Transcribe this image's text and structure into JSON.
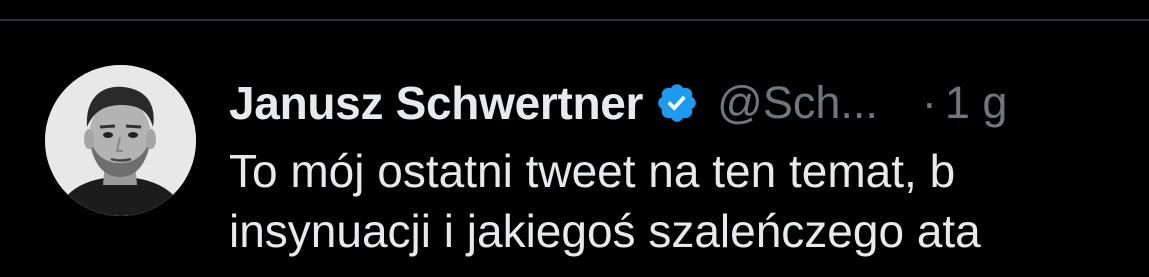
{
  "tweet": {
    "display_name": "Janusz Schwertner",
    "verified_icon": "verified-badge-icon",
    "handle": "@Sch...",
    "separator": "·",
    "time": "1 g",
    "text_lines": [
      "To mój ostatni tweet na ten temat, b",
      "insynuacji i jakiegoś szaleńczego ata"
    ]
  },
  "colors": {
    "background": "#000000",
    "primary_text": "#e7e9ea",
    "secondary_text": "#71767b",
    "verified_blue": "#1d9bf0",
    "divider": "#2f3336"
  }
}
